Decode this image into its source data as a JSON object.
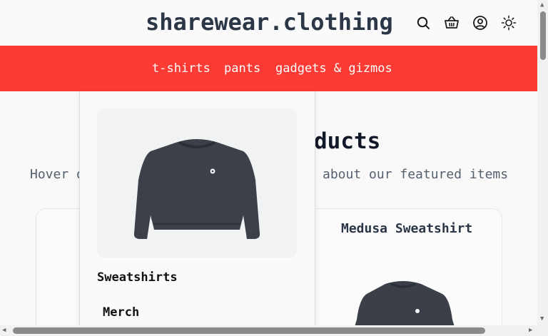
{
  "header": {
    "brand": "sharewear.clothing",
    "icons": [
      "search-icon",
      "basket-icon",
      "account-icon",
      "theme-toggle-icon"
    ]
  },
  "nav": {
    "items": [
      {
        "label": "t-shirts"
      },
      {
        "label": "pants"
      },
      {
        "label": "gadgets & gizmos"
      }
    ]
  },
  "main": {
    "section_title_visible": "ducts",
    "subtitle_left_visible": "Hover o",
    "subtitle_right_visible": "about our featured items",
    "featured_card_title": "Medusa Sweatshirt"
  },
  "dropdown": {
    "category": "Sweatshirts",
    "link": "Merch"
  },
  "colors": {
    "accent": "#fb3b34",
    "brand_text": "#2b3646",
    "background": "#f9f9fa"
  }
}
